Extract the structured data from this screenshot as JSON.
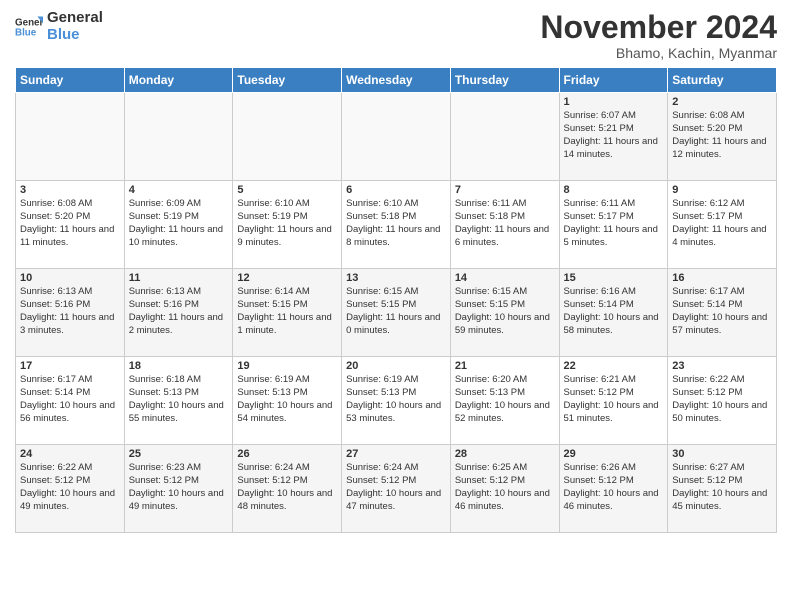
{
  "logo": {
    "line1": "General",
    "line2": "Blue"
  },
  "title": "November 2024",
  "location": "Bhamo, Kachin, Myanmar",
  "weekdays": [
    "Sunday",
    "Monday",
    "Tuesday",
    "Wednesday",
    "Thursday",
    "Friday",
    "Saturday"
  ],
  "weeks": [
    [
      {
        "day": "",
        "info": ""
      },
      {
        "day": "",
        "info": ""
      },
      {
        "day": "",
        "info": ""
      },
      {
        "day": "",
        "info": ""
      },
      {
        "day": "",
        "info": ""
      },
      {
        "day": "1",
        "info": "Sunrise: 6:07 AM\nSunset: 5:21 PM\nDaylight: 11 hours and 14 minutes."
      },
      {
        "day": "2",
        "info": "Sunrise: 6:08 AM\nSunset: 5:20 PM\nDaylight: 11 hours and 12 minutes."
      }
    ],
    [
      {
        "day": "3",
        "info": "Sunrise: 6:08 AM\nSunset: 5:20 PM\nDaylight: 11 hours and 11 minutes."
      },
      {
        "day": "4",
        "info": "Sunrise: 6:09 AM\nSunset: 5:19 PM\nDaylight: 11 hours and 10 minutes."
      },
      {
        "day": "5",
        "info": "Sunrise: 6:10 AM\nSunset: 5:19 PM\nDaylight: 11 hours and 9 minutes."
      },
      {
        "day": "6",
        "info": "Sunrise: 6:10 AM\nSunset: 5:18 PM\nDaylight: 11 hours and 8 minutes."
      },
      {
        "day": "7",
        "info": "Sunrise: 6:11 AM\nSunset: 5:18 PM\nDaylight: 11 hours and 6 minutes."
      },
      {
        "day": "8",
        "info": "Sunrise: 6:11 AM\nSunset: 5:17 PM\nDaylight: 11 hours and 5 minutes."
      },
      {
        "day": "9",
        "info": "Sunrise: 6:12 AM\nSunset: 5:17 PM\nDaylight: 11 hours and 4 minutes."
      }
    ],
    [
      {
        "day": "10",
        "info": "Sunrise: 6:13 AM\nSunset: 5:16 PM\nDaylight: 11 hours and 3 minutes."
      },
      {
        "day": "11",
        "info": "Sunrise: 6:13 AM\nSunset: 5:16 PM\nDaylight: 11 hours and 2 minutes."
      },
      {
        "day": "12",
        "info": "Sunrise: 6:14 AM\nSunset: 5:15 PM\nDaylight: 11 hours and 1 minute."
      },
      {
        "day": "13",
        "info": "Sunrise: 6:15 AM\nSunset: 5:15 PM\nDaylight: 11 hours and 0 minutes."
      },
      {
        "day": "14",
        "info": "Sunrise: 6:15 AM\nSunset: 5:15 PM\nDaylight: 10 hours and 59 minutes."
      },
      {
        "day": "15",
        "info": "Sunrise: 6:16 AM\nSunset: 5:14 PM\nDaylight: 10 hours and 58 minutes."
      },
      {
        "day": "16",
        "info": "Sunrise: 6:17 AM\nSunset: 5:14 PM\nDaylight: 10 hours and 57 minutes."
      }
    ],
    [
      {
        "day": "17",
        "info": "Sunrise: 6:17 AM\nSunset: 5:14 PM\nDaylight: 10 hours and 56 minutes."
      },
      {
        "day": "18",
        "info": "Sunrise: 6:18 AM\nSunset: 5:13 PM\nDaylight: 10 hours and 55 minutes."
      },
      {
        "day": "19",
        "info": "Sunrise: 6:19 AM\nSunset: 5:13 PM\nDaylight: 10 hours and 54 minutes."
      },
      {
        "day": "20",
        "info": "Sunrise: 6:19 AM\nSunset: 5:13 PM\nDaylight: 10 hours and 53 minutes."
      },
      {
        "day": "21",
        "info": "Sunrise: 6:20 AM\nSunset: 5:13 PM\nDaylight: 10 hours and 52 minutes."
      },
      {
        "day": "22",
        "info": "Sunrise: 6:21 AM\nSunset: 5:12 PM\nDaylight: 10 hours and 51 minutes."
      },
      {
        "day": "23",
        "info": "Sunrise: 6:22 AM\nSunset: 5:12 PM\nDaylight: 10 hours and 50 minutes."
      }
    ],
    [
      {
        "day": "24",
        "info": "Sunrise: 6:22 AM\nSunset: 5:12 PM\nDaylight: 10 hours and 49 minutes."
      },
      {
        "day": "25",
        "info": "Sunrise: 6:23 AM\nSunset: 5:12 PM\nDaylight: 10 hours and 49 minutes."
      },
      {
        "day": "26",
        "info": "Sunrise: 6:24 AM\nSunset: 5:12 PM\nDaylight: 10 hours and 48 minutes."
      },
      {
        "day": "27",
        "info": "Sunrise: 6:24 AM\nSunset: 5:12 PM\nDaylight: 10 hours and 47 minutes."
      },
      {
        "day": "28",
        "info": "Sunrise: 6:25 AM\nSunset: 5:12 PM\nDaylight: 10 hours and 46 minutes."
      },
      {
        "day": "29",
        "info": "Sunrise: 6:26 AM\nSunset: 5:12 PM\nDaylight: 10 hours and 46 minutes."
      },
      {
        "day": "30",
        "info": "Sunrise: 6:27 AM\nSunset: 5:12 PM\nDaylight: 10 hours and 45 minutes."
      }
    ]
  ]
}
